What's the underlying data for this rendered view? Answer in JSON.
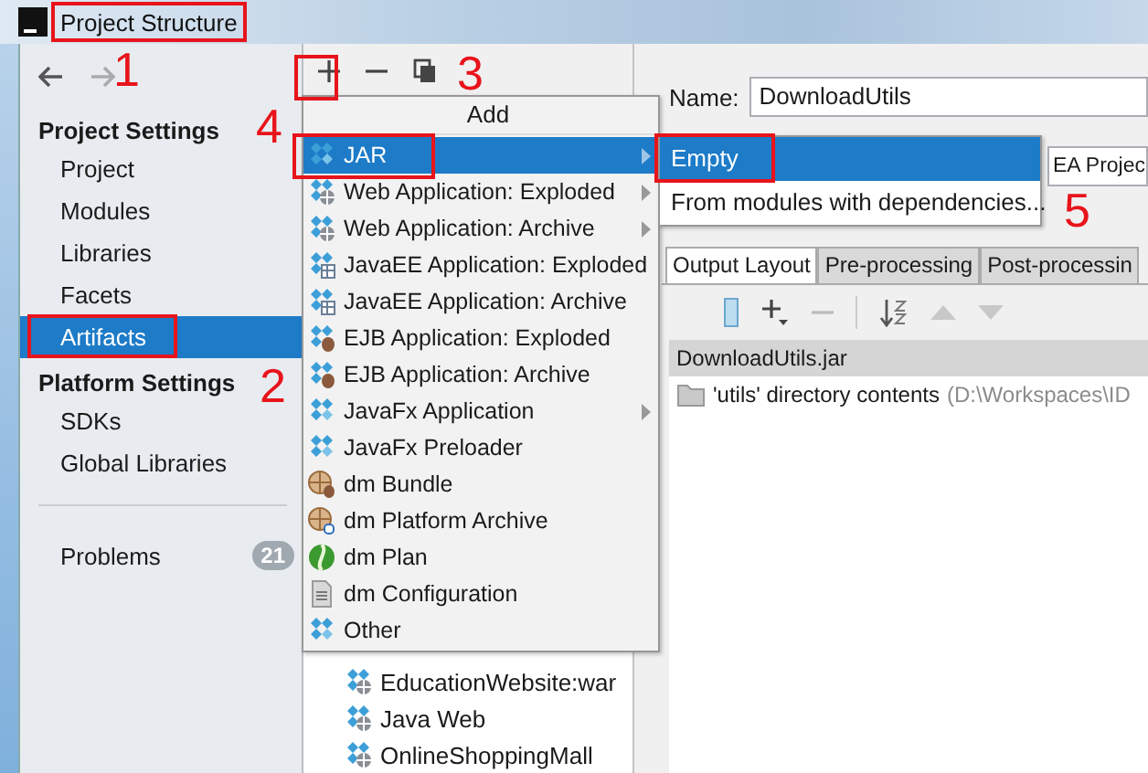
{
  "window": {
    "title": "Project Structure"
  },
  "sidebar": {
    "sections": [
      {
        "heading": "Project Settings",
        "items": [
          {
            "label": "Project",
            "selected": false
          },
          {
            "label": "Modules",
            "selected": false
          },
          {
            "label": "Libraries",
            "selected": false
          },
          {
            "label": "Facets",
            "selected": false
          },
          {
            "label": "Artifacts",
            "selected": true
          }
        ]
      },
      {
        "heading": "Platform Settings",
        "items": [
          {
            "label": "SDKs",
            "selected": false
          },
          {
            "label": "Global Libraries",
            "selected": false
          }
        ]
      }
    ],
    "problems": {
      "label": "Problems",
      "count": "21"
    }
  },
  "artifacts": {
    "items": [
      {
        "label": "EducationWebsite:war",
        "kind": "web",
        "selected": false
      },
      {
        "label": "Java Web",
        "kind": "web",
        "selected": false
      },
      {
        "label": "OnlineShoppingMall",
        "kind": "web",
        "selected": false
      }
    ]
  },
  "details": {
    "name_label": "Name:",
    "name_value": "DownloadUtils",
    "output_directory_value": "EA Projec",
    "tabs": [
      {
        "label": "Output Layout",
        "selected": true
      },
      {
        "label": "Pre-processing",
        "selected": false
      },
      {
        "label": "Post-processin",
        "selected": false
      }
    ],
    "layout_rows": [
      {
        "label": "DownloadUtils.jar",
        "kind": "archive",
        "selected": true
      },
      {
        "label": "'utils' directory contents",
        "hint": "(D:\\Workspaces\\ID",
        "kind": "directory",
        "selected": false
      }
    ]
  },
  "add_menu": {
    "title": "Add",
    "items": [
      {
        "label": "JAR",
        "kind": "jar",
        "submenu": true,
        "selected": true
      },
      {
        "label": "Web Application: Exploded",
        "kind": "web",
        "submenu": true,
        "selected": false
      },
      {
        "label": "Web Application: Archive",
        "kind": "web",
        "submenu": true,
        "selected": false
      },
      {
        "label": "JavaEE Application: Exploded",
        "kind": "javaee",
        "submenu": false,
        "selected": false
      },
      {
        "label": "JavaEE Application: Archive",
        "kind": "javaee",
        "submenu": false,
        "selected": false
      },
      {
        "label": "EJB Application: Exploded",
        "kind": "ejb",
        "submenu": false,
        "selected": false
      },
      {
        "label": "EJB Application: Archive",
        "kind": "ejb",
        "submenu": false,
        "selected": false
      },
      {
        "label": "JavaFx Application",
        "kind": "jar",
        "submenu": true,
        "selected": false
      },
      {
        "label": "JavaFx Preloader",
        "kind": "jar",
        "submenu": false,
        "selected": false
      },
      {
        "label": "dm Bundle",
        "kind": "bundle",
        "submenu": false,
        "selected": false
      },
      {
        "label": "dm Platform Archive",
        "kind": "platform",
        "submenu": false,
        "selected": false
      },
      {
        "label": "dm Plan",
        "kind": "plan",
        "submenu": false,
        "selected": false
      },
      {
        "label": "dm Configuration",
        "kind": "config",
        "submenu": false,
        "selected": false
      },
      {
        "label": "Other",
        "kind": "jar",
        "submenu": false,
        "selected": false
      }
    ]
  },
  "jar_submenu": {
    "items": [
      {
        "label": "Empty",
        "selected": true
      },
      {
        "label": "From modules with dependencies...",
        "selected": false
      }
    ]
  },
  "annotations": [
    {
      "number": "1"
    },
    {
      "number": "2"
    },
    {
      "number": "3"
    },
    {
      "number": "4"
    },
    {
      "number": "5"
    }
  ]
}
